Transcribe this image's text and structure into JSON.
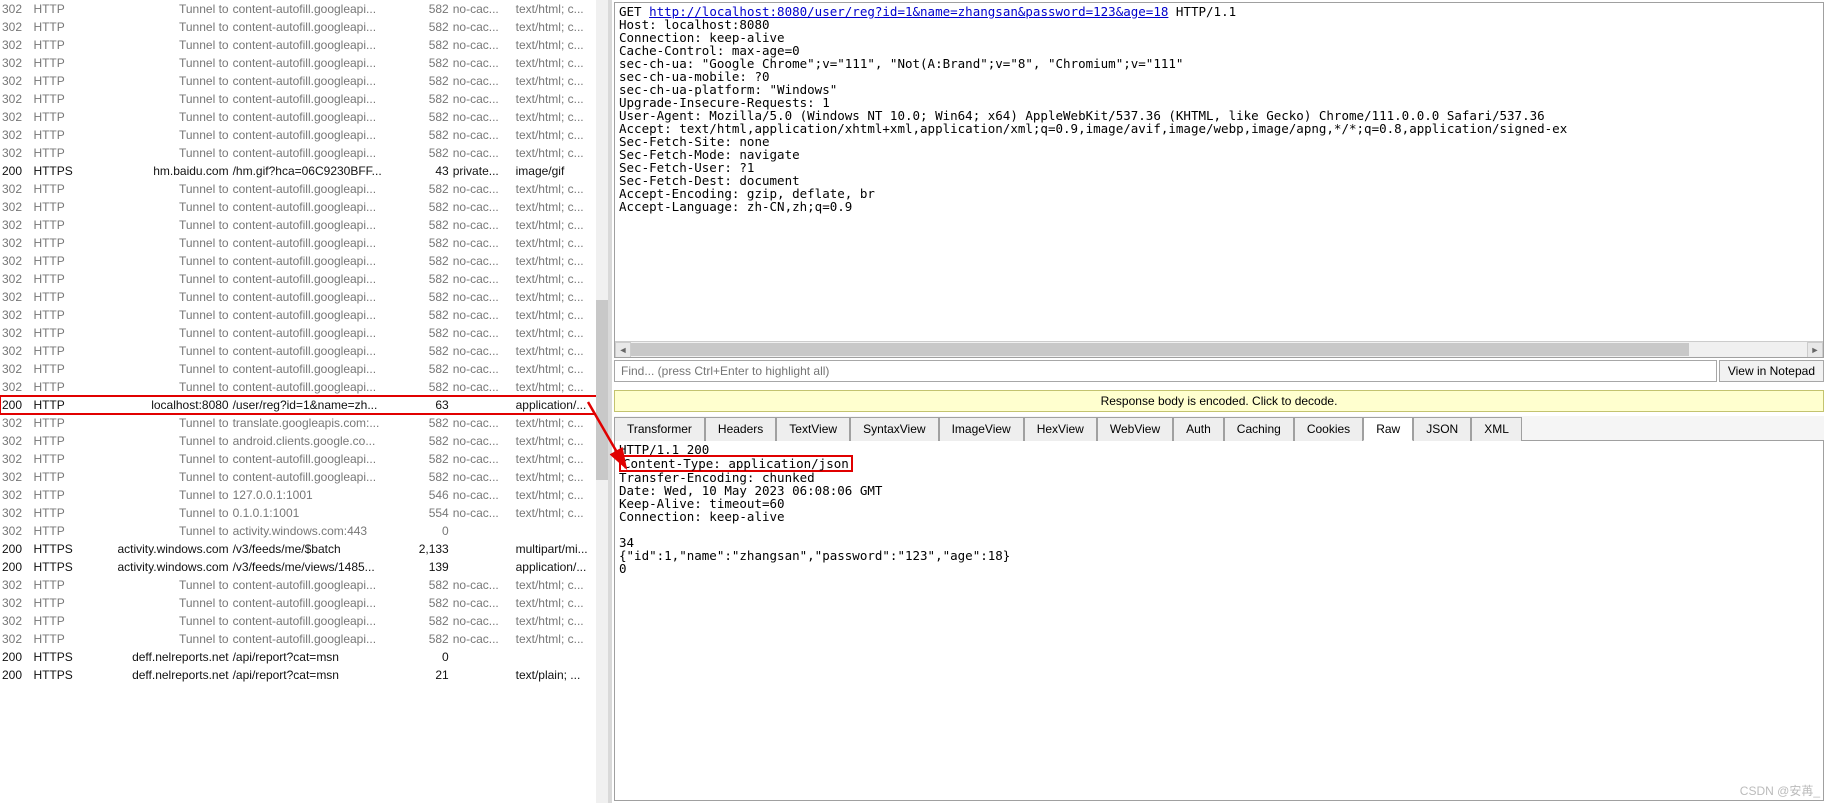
{
  "sessions": [
    {
      "result": "302",
      "protocol": "HTTP",
      "host": "Tunnel to",
      "url": "content-autofill.googleapi...",
      "body": "582",
      "caching": "no-cac...",
      "ct": "text/html; c...",
      "cls": "grey"
    },
    {
      "result": "302",
      "protocol": "HTTP",
      "host": "Tunnel to",
      "url": "content-autofill.googleapi...",
      "body": "582",
      "caching": "no-cac...",
      "ct": "text/html; c...",
      "cls": "grey"
    },
    {
      "result": "302",
      "protocol": "HTTP",
      "host": "Tunnel to",
      "url": "content-autofill.googleapi...",
      "body": "582",
      "caching": "no-cac...",
      "ct": "text/html; c...",
      "cls": "grey"
    },
    {
      "result": "302",
      "protocol": "HTTP",
      "host": "Tunnel to",
      "url": "content-autofill.googleapi...",
      "body": "582",
      "caching": "no-cac...",
      "ct": "text/html; c...",
      "cls": "grey"
    },
    {
      "result": "302",
      "protocol": "HTTP",
      "host": "Tunnel to",
      "url": "content-autofill.googleapi...",
      "body": "582",
      "caching": "no-cac...",
      "ct": "text/html; c...",
      "cls": "grey"
    },
    {
      "result": "302",
      "protocol": "HTTP",
      "host": "Tunnel to",
      "url": "content-autofill.googleapi...",
      "body": "582",
      "caching": "no-cac...",
      "ct": "text/html; c...",
      "cls": "grey"
    },
    {
      "result": "302",
      "protocol": "HTTP",
      "host": "Tunnel to",
      "url": "content-autofill.googleapi...",
      "body": "582",
      "caching": "no-cac...",
      "ct": "text/html; c...",
      "cls": "grey"
    },
    {
      "result": "302",
      "protocol": "HTTP",
      "host": "Tunnel to",
      "url": "content-autofill.googleapi...",
      "body": "582",
      "caching": "no-cac...",
      "ct": "text/html; c...",
      "cls": "grey"
    },
    {
      "result": "302",
      "protocol": "HTTP",
      "host": "Tunnel to",
      "url": "content-autofill.googleapi...",
      "body": "582",
      "caching": "no-cac...",
      "ct": "text/html; c...",
      "cls": "grey"
    },
    {
      "result": "200",
      "protocol": "HTTPS",
      "host": "hm.baidu.com",
      "url": "/hm.gif?hca=06C9230BFF...",
      "body": "43",
      "caching": "private...",
      "ct": "image/gif",
      "cls": "black"
    },
    {
      "result": "302",
      "protocol": "HTTP",
      "host": "Tunnel to",
      "url": "content-autofill.googleapi...",
      "body": "582",
      "caching": "no-cac...",
      "ct": "text/html; c...",
      "cls": "grey"
    },
    {
      "result": "302",
      "protocol": "HTTP",
      "host": "Tunnel to",
      "url": "content-autofill.googleapi...",
      "body": "582",
      "caching": "no-cac...",
      "ct": "text/html; c...",
      "cls": "grey"
    },
    {
      "result": "302",
      "protocol": "HTTP",
      "host": "Tunnel to",
      "url": "content-autofill.googleapi...",
      "body": "582",
      "caching": "no-cac...",
      "ct": "text/html; c...",
      "cls": "grey"
    },
    {
      "result": "302",
      "protocol": "HTTP",
      "host": "Tunnel to",
      "url": "content-autofill.googleapi...",
      "body": "582",
      "caching": "no-cac...",
      "ct": "text/html; c...",
      "cls": "grey"
    },
    {
      "result": "302",
      "protocol": "HTTP",
      "host": "Tunnel to",
      "url": "content-autofill.googleapi...",
      "body": "582",
      "caching": "no-cac...",
      "ct": "text/html; c...",
      "cls": "grey"
    },
    {
      "result": "302",
      "protocol": "HTTP",
      "host": "Tunnel to",
      "url": "content-autofill.googleapi...",
      "body": "582",
      "caching": "no-cac...",
      "ct": "text/html; c...",
      "cls": "grey"
    },
    {
      "result": "302",
      "protocol": "HTTP",
      "host": "Tunnel to",
      "url": "content-autofill.googleapi...",
      "body": "582",
      "caching": "no-cac...",
      "ct": "text/html; c...",
      "cls": "grey"
    },
    {
      "result": "302",
      "protocol": "HTTP",
      "host": "Tunnel to",
      "url": "content-autofill.googleapi...",
      "body": "582",
      "caching": "no-cac...",
      "ct": "text/html; c...",
      "cls": "grey"
    },
    {
      "result": "302",
      "protocol": "HTTP",
      "host": "Tunnel to",
      "url": "content-autofill.googleapi...",
      "body": "582",
      "caching": "no-cac...",
      "ct": "text/html; c...",
      "cls": "grey"
    },
    {
      "result": "302",
      "protocol": "HTTP",
      "host": "Tunnel to",
      "url": "content-autofill.googleapi...",
      "body": "582",
      "caching": "no-cac...",
      "ct": "text/html; c...",
      "cls": "grey"
    },
    {
      "result": "302",
      "protocol": "HTTP",
      "host": "Tunnel to",
      "url": "content-autofill.googleapi...",
      "body": "582",
      "caching": "no-cac...",
      "ct": "text/html; c...",
      "cls": "grey"
    },
    {
      "result": "302",
      "protocol": "HTTP",
      "host": "Tunnel to",
      "url": "content-autofill.googleapi...",
      "body": "582",
      "caching": "no-cac...",
      "ct": "text/html; c...",
      "cls": "grey"
    },
    {
      "result": "200",
      "protocol": "HTTP",
      "host": "localhost:8080",
      "url": "/user/reg?id=1&name=zh...",
      "body": "63",
      "caching": "",
      "ct": "application/...",
      "cls": "black",
      "highlight": true
    },
    {
      "result": "302",
      "protocol": "HTTP",
      "host": "Tunnel to",
      "url": "translate.googleapis.com:...",
      "body": "582",
      "caching": "no-cac...",
      "ct": "text/html; c...",
      "cls": "grey"
    },
    {
      "result": "302",
      "protocol": "HTTP",
      "host": "Tunnel to",
      "url": "android.clients.google.co...",
      "body": "582",
      "caching": "no-cac...",
      "ct": "text/html; c...",
      "cls": "grey"
    },
    {
      "result": "302",
      "protocol": "HTTP",
      "host": "Tunnel to",
      "url": "content-autofill.googleapi...",
      "body": "582",
      "caching": "no-cac...",
      "ct": "text/html; c...",
      "cls": "grey"
    },
    {
      "result": "302",
      "protocol": "HTTP",
      "host": "Tunnel to",
      "url": "content-autofill.googleapi...",
      "body": "582",
      "caching": "no-cac...",
      "ct": "text/html; c...",
      "cls": "grey"
    },
    {
      "result": "302",
      "protocol": "HTTP",
      "host": "Tunnel to",
      "url": "127.0.0.1:1001",
      "body": "546",
      "caching": "no-cac...",
      "ct": "text/html; c...",
      "cls": "grey"
    },
    {
      "result": "302",
      "protocol": "HTTP",
      "host": "Tunnel to",
      "url": "0.1.0.1:1001",
      "body": "554",
      "caching": "no-cac...",
      "ct": "text/html; c...",
      "cls": "grey"
    },
    {
      "result": "302",
      "protocol": "HTTP",
      "host": "Tunnel to",
      "url": "activity.windows.com:443",
      "body": "0",
      "caching": "",
      "ct": "",
      "cls": "grey"
    },
    {
      "result": "200",
      "protocol": "HTTPS",
      "host": "activity.windows.com",
      "url": "/v3/feeds/me/$batch",
      "body": "2,133",
      "caching": "",
      "ct": "multipart/mi...",
      "cls": "black"
    },
    {
      "result": "200",
      "protocol": "HTTPS",
      "host": "activity.windows.com",
      "url": "/v3/feeds/me/views/1485...",
      "body": "139",
      "caching": "",
      "ct": "application/...",
      "cls": "black"
    },
    {
      "result": "302",
      "protocol": "HTTP",
      "host": "Tunnel to",
      "url": "content-autofill.googleapi...",
      "body": "582",
      "caching": "no-cac...",
      "ct": "text/html; c...",
      "cls": "grey"
    },
    {
      "result": "302",
      "protocol": "HTTP",
      "host": "Tunnel to",
      "url": "content-autofill.googleapi...",
      "body": "582",
      "caching": "no-cac...",
      "ct": "text/html; c...",
      "cls": "grey"
    },
    {
      "result": "302",
      "protocol": "HTTP",
      "host": "Tunnel to",
      "url": "content-autofill.googleapi...",
      "body": "582",
      "caching": "no-cac...",
      "ct": "text/html; c...",
      "cls": "grey"
    },
    {
      "result": "302",
      "protocol": "HTTP",
      "host": "Tunnel to",
      "url": "content-autofill.googleapi...",
      "body": "582",
      "caching": "no-cac...",
      "ct": "text/html; c...",
      "cls": "grey"
    },
    {
      "result": "200",
      "protocol": "HTTPS",
      "host": "deff.nelreports.net",
      "url": "/api/report?cat=msn",
      "body": "0",
      "caching": "",
      "ct": "",
      "cls": "black"
    },
    {
      "result": "200",
      "protocol": "HTTPS",
      "host": "deff.nelreports.net",
      "url": "/api/report?cat=msn",
      "body": "21",
      "caching": "",
      "ct": "text/plain; ...",
      "cls": "black"
    }
  ],
  "request": {
    "method": "GET ",
    "url": "http://localhost:8080/user/reg?id=1&name=zhangsan&password=123&age=18",
    "protocol": " HTTP/1.1",
    "headers": [
      "Host: localhost:8080",
      "Connection: keep-alive",
      "Cache-Control: max-age=0",
      "sec-ch-ua: \"Google Chrome\";v=\"111\", \"Not(A:Brand\";v=\"8\", \"Chromium\";v=\"111\"",
      "sec-ch-ua-mobile: ?0",
      "sec-ch-ua-platform: \"Windows\"",
      "Upgrade-Insecure-Requests: 1",
      "User-Agent: Mozilla/5.0 (Windows NT 10.0; Win64; x64) AppleWebKit/537.36 (KHTML, like Gecko) Chrome/111.0.0.0 Safari/537.36",
      "Accept: text/html,application/xhtml+xml,application/xml;q=0.9,image/avif,image/webp,image/apng,*/*;q=0.8,application/signed-ex",
      "Sec-Fetch-Site: none",
      "Sec-Fetch-Mode: navigate",
      "Sec-Fetch-User: ?1",
      "Sec-Fetch-Dest: document",
      "Accept-Encoding: gzip, deflate, br",
      "Accept-Language: zh-CN,zh;q=0.9"
    ]
  },
  "find": {
    "placeholder": "Find... (press Ctrl+Enter to highlight all)",
    "notepad_label": "View in Notepad"
  },
  "decode_bar": "Response body is encoded. Click to decode.",
  "response_tabs": [
    "Transformer",
    "Headers",
    "TextView",
    "SyntaxView",
    "ImageView",
    "HexView",
    "WebView",
    "Auth",
    "Caching",
    "Cookies",
    "Raw",
    "JSON",
    "XML"
  ],
  "response_active_tab": "Raw",
  "response": {
    "status_line": "HTTP/1.1 200",
    "ct_line": "Content-Type: application/json",
    "rest": [
      "Transfer-Encoding: chunked",
      "Date: Wed, 10 May 2023 06:08:06 GMT",
      "Keep-Alive: timeout=60",
      "Connection: keep-alive",
      "",
      "34",
      "{\"id\":1,\"name\":\"zhangsan\",\"password\":\"123\",\"age\":18}",
      "0"
    ]
  },
  "watermark": "CSDN @安苒_"
}
